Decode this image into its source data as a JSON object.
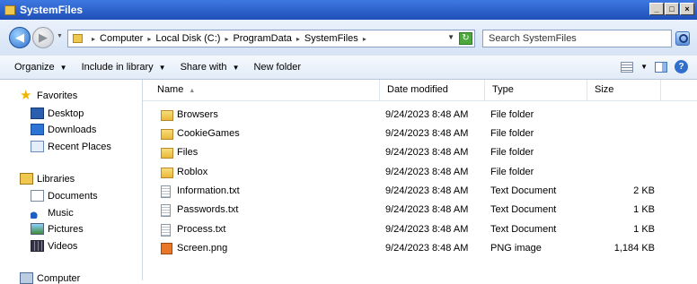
{
  "window": {
    "title": "SystemFiles"
  },
  "address": {
    "crumbs": [
      "Computer",
      "Local Disk (C:)",
      "ProgramData",
      "SystemFiles"
    ]
  },
  "search": {
    "placeholder": "Search SystemFiles"
  },
  "toolbar": {
    "organize": "Organize",
    "include": "Include in library",
    "share": "Share with",
    "new_folder": "New folder"
  },
  "nav": {
    "favorites": {
      "label": "Favorites",
      "items": [
        "Desktop",
        "Downloads",
        "Recent Places"
      ]
    },
    "libraries": {
      "label": "Libraries",
      "items": [
        "Documents",
        "Music",
        "Pictures",
        "Videos"
      ]
    },
    "computer": "Computer"
  },
  "columns": {
    "name": "Name",
    "date": "Date modified",
    "type": "Type",
    "size": "Size"
  },
  "files": [
    {
      "name": "Browsers",
      "date": "9/24/2023 8:48 AM",
      "type": "File folder",
      "size": ""
    },
    {
      "name": "CookieGames",
      "date": "9/24/2023 8:48 AM",
      "type": "File folder",
      "size": ""
    },
    {
      "name": "Files",
      "date": "9/24/2023 8:48 AM",
      "type": "File folder",
      "size": ""
    },
    {
      "name": "Roblox",
      "date": "9/24/2023 8:48 AM",
      "type": "File folder",
      "size": ""
    },
    {
      "name": "Information.txt",
      "date": "9/24/2023 8:48 AM",
      "type": "Text Document",
      "size": "2 KB"
    },
    {
      "name": "Passwords.txt",
      "date": "9/24/2023 8:48 AM",
      "type": "Text Document",
      "size": "1 KB"
    },
    {
      "name": "Process.txt",
      "date": "9/24/2023 8:48 AM",
      "type": "Text Document",
      "size": "1 KB"
    },
    {
      "name": "Screen.png",
      "date": "9/24/2023 8:48 AM",
      "type": "PNG image",
      "size": "1,184 KB"
    }
  ]
}
